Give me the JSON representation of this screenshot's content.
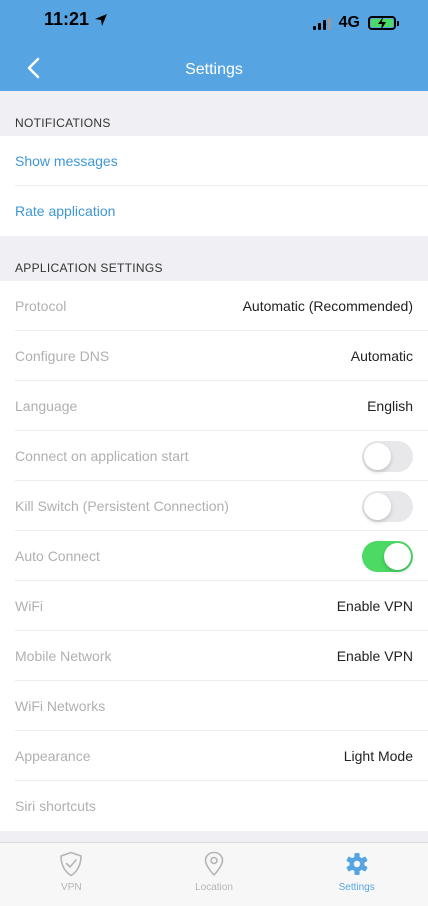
{
  "status_bar": {
    "time": "11:21",
    "network": "4G"
  },
  "header": {
    "title": "Settings"
  },
  "notifications": {
    "header": "NOTIFICATIONS",
    "items": [
      "Show messages",
      "Rate application"
    ]
  },
  "app_settings": {
    "header": "APPLICATION SETTINGS",
    "protocol": {
      "label": "Protocol",
      "value": "Automatic (Recommended)"
    },
    "dns": {
      "label": "Configure DNS",
      "value": "Automatic"
    },
    "language": {
      "label": "Language",
      "value": "English"
    },
    "connect_on_start": {
      "label": "Connect on application start",
      "enabled": false
    },
    "kill_switch": {
      "label": "Kill Switch (Persistent Connection)",
      "enabled": false
    },
    "auto_connect": {
      "label": "Auto Connect",
      "enabled": true
    },
    "wifi": {
      "label": "WiFi",
      "value": "Enable VPN"
    },
    "mobile_network": {
      "label": "Mobile Network",
      "value": "Enable VPN"
    },
    "wifi_networks": {
      "label": "WiFi Networks"
    },
    "appearance": {
      "label": "Appearance",
      "value": "Light Mode"
    },
    "siri": {
      "label": "Siri shortcuts"
    }
  },
  "tabbar": {
    "vpn": "VPN",
    "location": "Location",
    "settings": "Settings"
  },
  "colors": {
    "accent": "#56a5e2",
    "link": "#3f97d5",
    "toggle_on": "#4cd964"
  }
}
